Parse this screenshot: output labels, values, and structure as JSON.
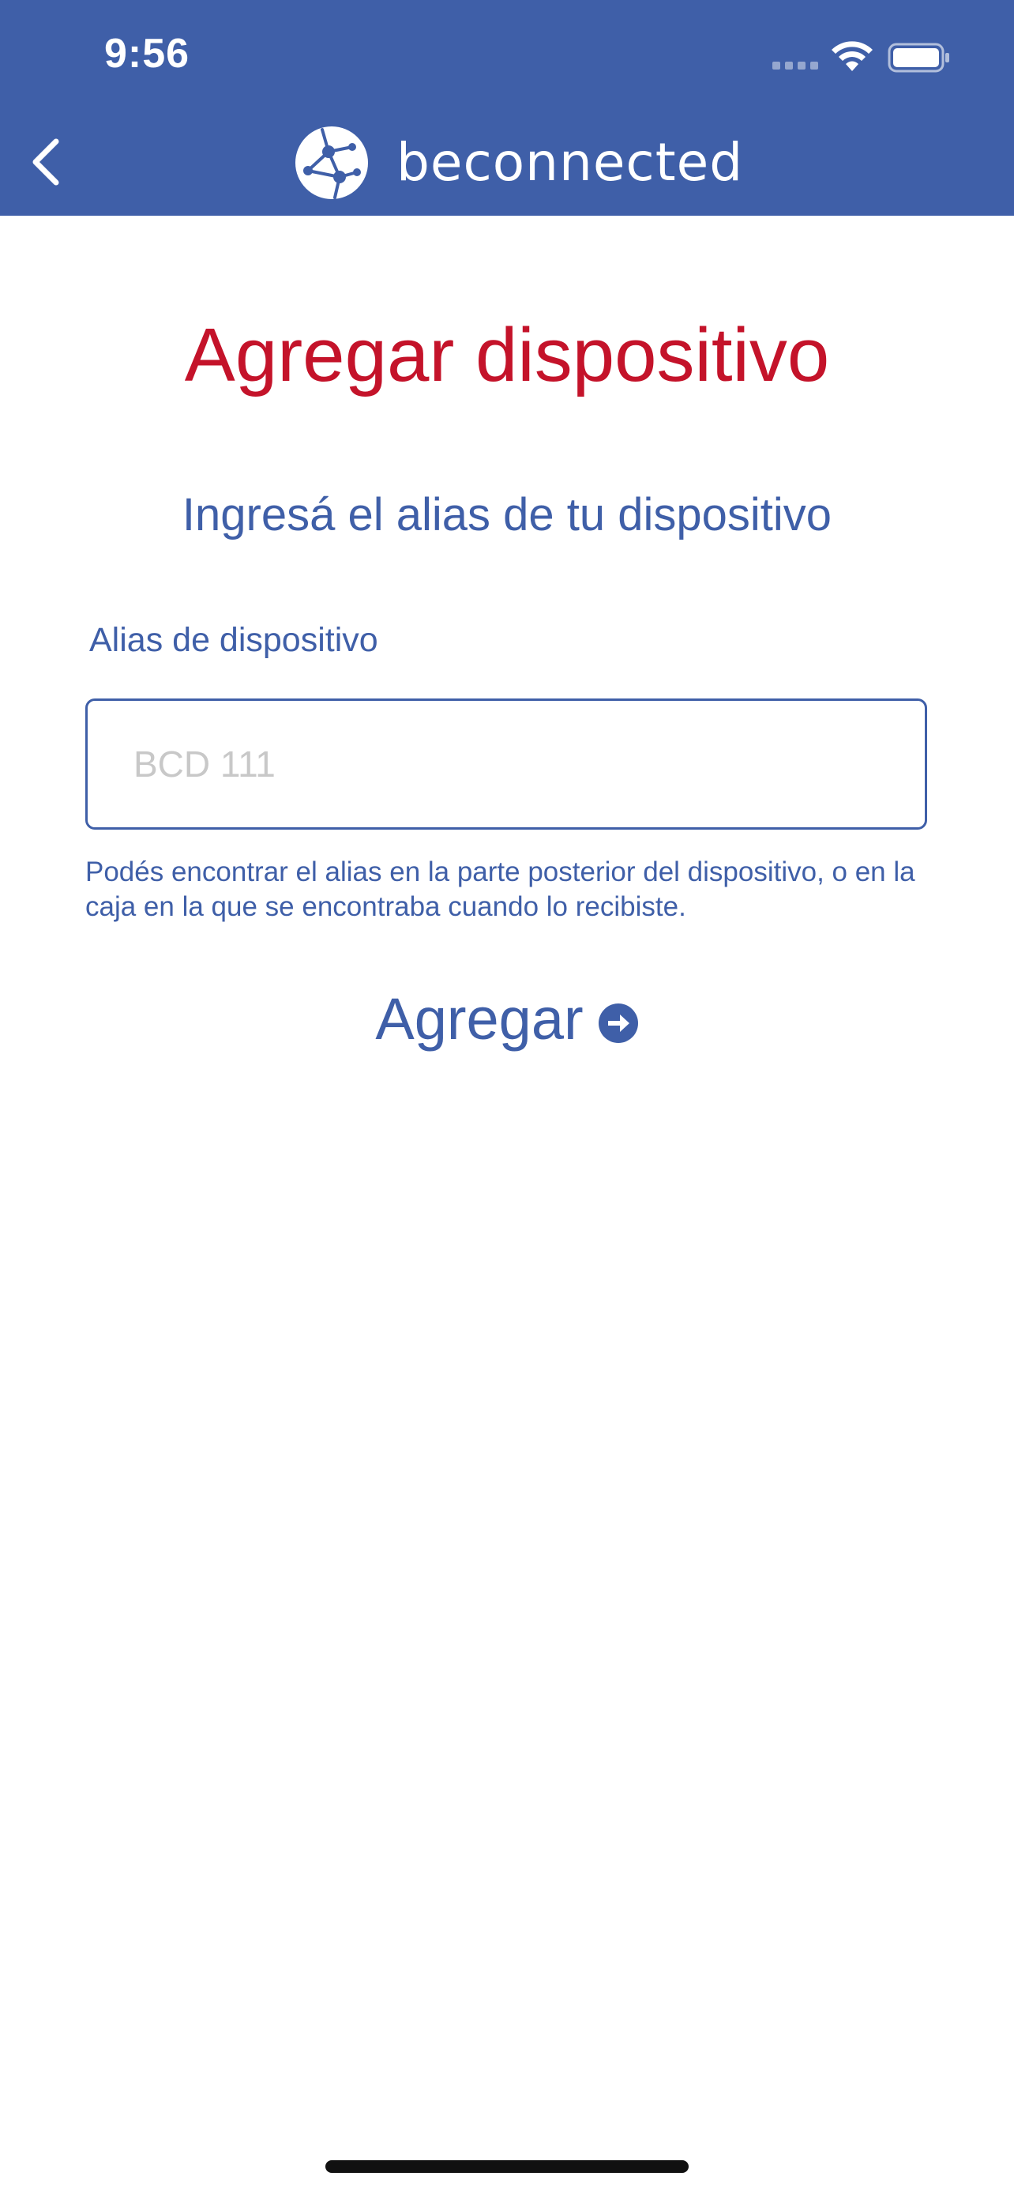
{
  "status_bar": {
    "time": "9:56"
  },
  "header": {
    "back_icon": "chevron-left-icon",
    "logo_icon": "network-globe-icon",
    "brand_name": "beconnected",
    "background_color": "#3f5fa8"
  },
  "main": {
    "title": "Agregar dispositivo",
    "subtitle": "Ingresá el alias de tu dispositivo",
    "alias_field": {
      "label": "Alias de dispositivo",
      "placeholder": "BCD 111",
      "value": ""
    },
    "hint": "Podés encontrar el alias  en la parte posterior del dispositivo, o en la caja en la que se encontraba cuando lo recibiste.",
    "add_button": {
      "label": "Agregar",
      "icon": "arrow-right-circle-icon"
    }
  },
  "colors": {
    "primary": "#3f5fa8",
    "title": "#c4132a",
    "placeholder": "#c8c8c8"
  }
}
